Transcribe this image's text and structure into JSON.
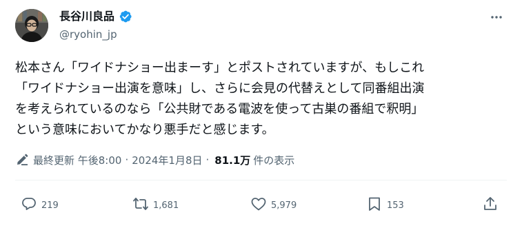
{
  "author": {
    "name": "長谷川良品",
    "handle": "@ryohin_jp",
    "verified_icon": "verified-badge-icon",
    "badge_color": "#1d9bf0"
  },
  "more_icon": "more-horizontal-icon",
  "tweet": {
    "text": "松本さん「ワイドナショー出まーす」とポストされていますが、もしこれ\n「ワイドナショー出演を意味」し、さらに会見の代替えとして同番組出演\nを考えられているのなら「公共財である電波を使って古巣の番組で釈明」\nという意味においてかなり悪手だと感じます。"
  },
  "meta": {
    "edit_icon": "pencil-icon",
    "last_edited": "最終更新 午後8:00",
    "separator1": "·",
    "date": "2024年1月8日",
    "separator2": "·",
    "views_count": "81.1万",
    "views_label": "件の表示"
  },
  "actions": {
    "reply": {
      "icon": "reply-icon",
      "count": "219"
    },
    "repost": {
      "icon": "repost-icon",
      "count": "1,681"
    },
    "like": {
      "icon": "heart-icon",
      "count": "5,979"
    },
    "bookmark": {
      "icon": "bookmark-icon",
      "count": "153"
    },
    "share": {
      "icon": "share-icon"
    }
  }
}
